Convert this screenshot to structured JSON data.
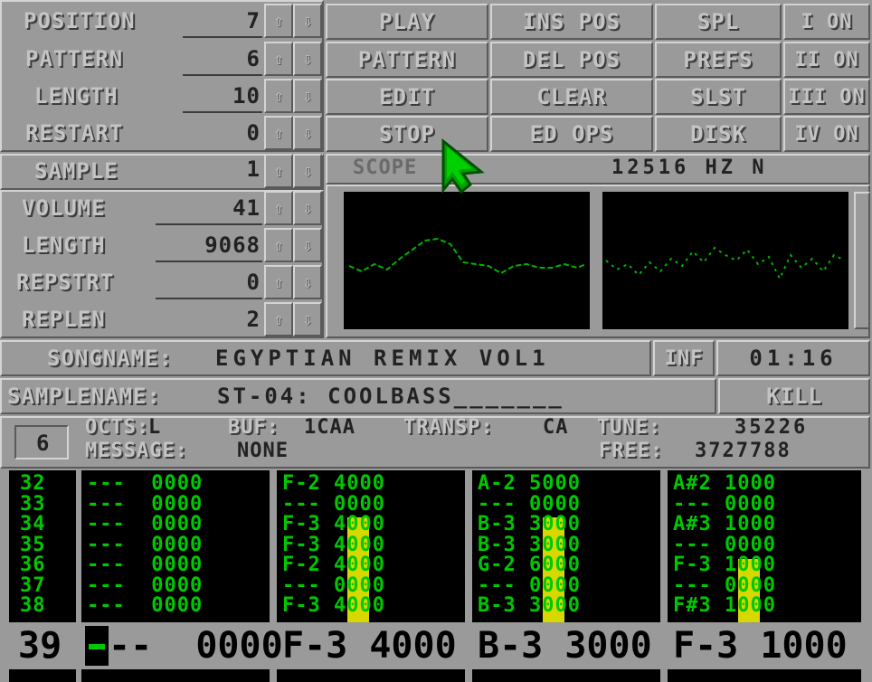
{
  "left": {
    "position": {
      "label": "POSITION",
      "value": "7"
    },
    "pattern": {
      "label": "PATTERN",
      "value": "6"
    },
    "length": {
      "label": "LENGTH",
      "value": "10"
    },
    "restart": {
      "label": "RESTART",
      "value": "0"
    },
    "sample": {
      "label": "SAMPLE",
      "value": "1"
    },
    "volume": {
      "label": "VOLUME",
      "value": "41"
    },
    "slength": {
      "label": "LENGTH",
      "value": "9068"
    },
    "repstrt": {
      "label": "REPSTRT",
      "value": "0"
    },
    "replen": {
      "label": "REPLEN",
      "value": "2"
    },
    "up_icon": "arrow-up-icon",
    "down_icon": "arrow-down-icon"
  },
  "buttons": {
    "play": "PLAY",
    "pattern": "PATTERN",
    "edit": "EDIT",
    "stop": "STOP",
    "ins_pos": "INS POS",
    "del_pos": "DEL POS",
    "clear": "CLEAR",
    "ed_ops": "ED OPS",
    "spl": "SPL",
    "prefs": "PREFS",
    "slst": "SLST",
    "disk": "DISK",
    "ch1": "I ON",
    "ch2": "II ON",
    "ch3": "III ON",
    "ch4": "IV ON"
  },
  "scope": {
    "label": "SCOPE",
    "rate": "12516 HZ N"
  },
  "song": {
    "label": "SONGNAME:",
    "name": "EGYPTIAN REMIX VOL1",
    "inf": "INF",
    "time": "01:16"
  },
  "samplename": {
    "label": "SAMPLENAME:",
    "name": "ST-04: COOLBASS_______",
    "kill": "KILL"
  },
  "info": {
    "octave_box": "6",
    "octs_label": "OCTS:",
    "octs": "L",
    "buf_label": "BUF:",
    "buf": "1CAA",
    "transp_label": "TRANSP:",
    "transp": "CA",
    "tune_label": "TUNE:",
    "tune": "35226",
    "message_label": "MESSAGE:",
    "message": "NONE",
    "free_label": "FREE:",
    "free": "3727788"
  },
  "tracker": {
    "rows": [
      "32",
      "33",
      "34",
      "35",
      "36",
      "37",
      "38"
    ],
    "ch1": [
      "---  0000",
      "---  0000",
      "---  0000",
      "---  0000",
      "---  0000",
      "---  0000",
      "---  0000"
    ],
    "ch2": [
      "F-2 4000",
      "--- 0000",
      "F-3 4000",
      "F-3 4000",
      "F-2 4000",
      "--- 0000",
      "F-3 4000"
    ],
    "ch3": [
      "A-2 5000",
      "--- 0000",
      "B-3 3000",
      "B-3 3000",
      "G-2 6000",
      "--- 0000",
      "B-3 3000"
    ],
    "ch4": [
      "A#2 1000",
      "--- 0000",
      "A#3 1000",
      "--- 0000",
      "F-3 1000",
      "--- 0000",
      "F#3 1000"
    ],
    "vu": [
      0.8,
      0.8,
      0.5
    ]
  },
  "current_row": {
    "num": "39",
    "ch1": "--  0000",
    "ch2": "F-3 4000",
    "ch3": "B-3 3000",
    "ch4": "F-3 1000"
  },
  "cursor_icon": "mouse-pointer-icon"
}
